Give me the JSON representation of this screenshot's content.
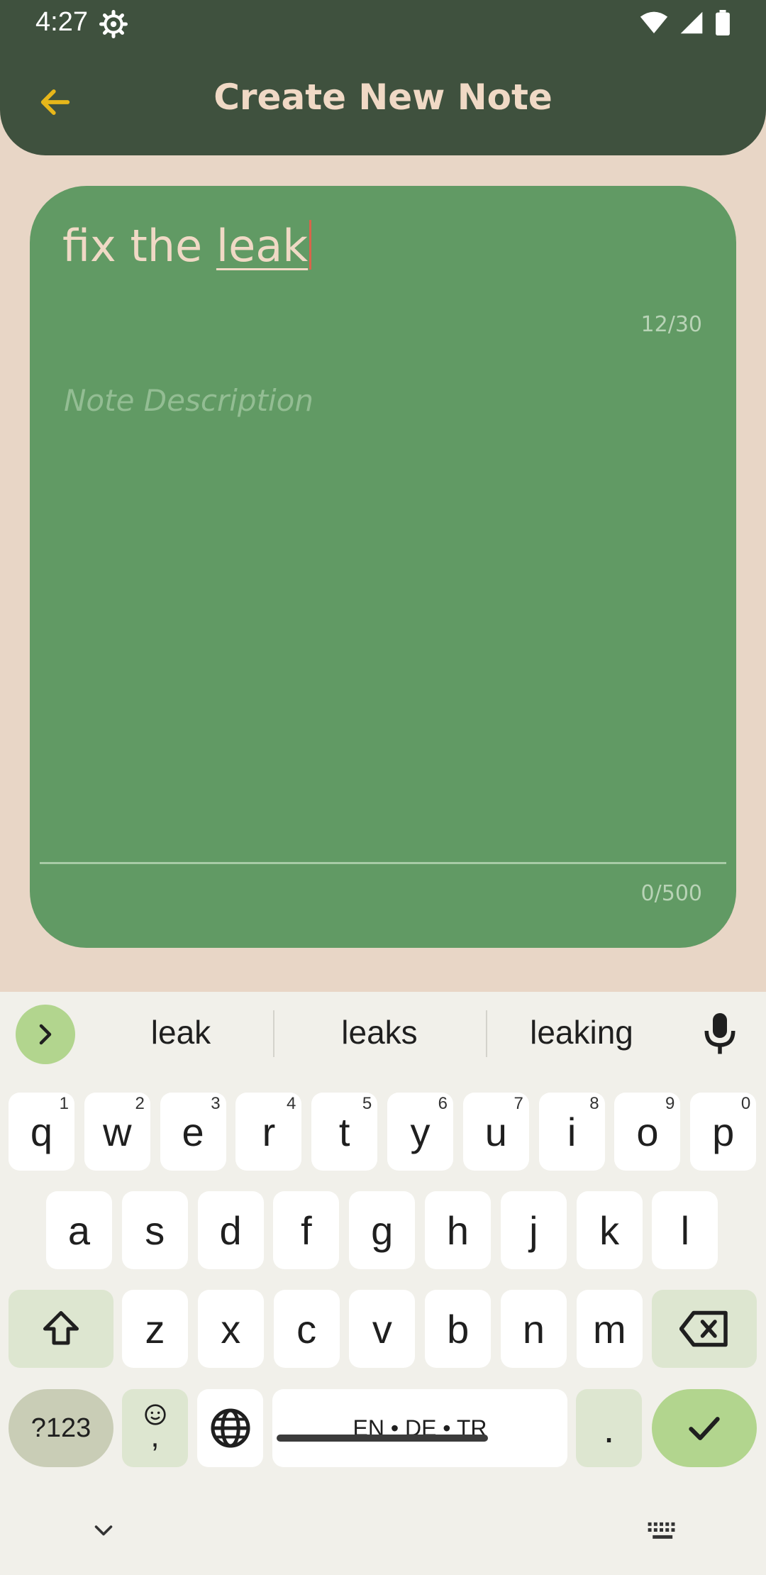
{
  "status_bar": {
    "time": "4:27",
    "icons": [
      "gear-icon",
      "wifi-icon",
      "signal-icon",
      "battery-icon"
    ]
  },
  "app_bar": {
    "title": "Create New Note",
    "back_icon": "arrow-left-icon",
    "background_color": "#3f513e",
    "title_color": "#f0d9c5",
    "back_color": "#e7b71a"
  },
  "note": {
    "title_prefix": "fix the ",
    "title_word": "leak",
    "title_counter": "12/30",
    "description_placeholder": "Note Description",
    "description_counter": "0/500",
    "card_color": "#619a64"
  },
  "keyboard": {
    "suggestions": [
      "leak",
      "leaks",
      "leaking"
    ],
    "row1": [
      {
        "k": "q",
        "h": "1"
      },
      {
        "k": "w",
        "h": "2"
      },
      {
        "k": "e",
        "h": "3"
      },
      {
        "k": "r",
        "h": "4"
      },
      {
        "k": "t",
        "h": "5"
      },
      {
        "k": "y",
        "h": "6"
      },
      {
        "k": "u",
        "h": "7"
      },
      {
        "k": "i",
        "h": "8"
      },
      {
        "k": "o",
        "h": "9"
      },
      {
        "k": "p",
        "h": "0"
      }
    ],
    "row2": [
      "a",
      "s",
      "d",
      "f",
      "g",
      "h",
      "j",
      "k",
      "l"
    ],
    "row3": [
      "z",
      "x",
      "c",
      "v",
      "b",
      "n",
      "m"
    ],
    "symbols_label": "?123",
    "emoji_comma": ",",
    "space_label": "EN • DE • TR",
    "period_label": "."
  }
}
